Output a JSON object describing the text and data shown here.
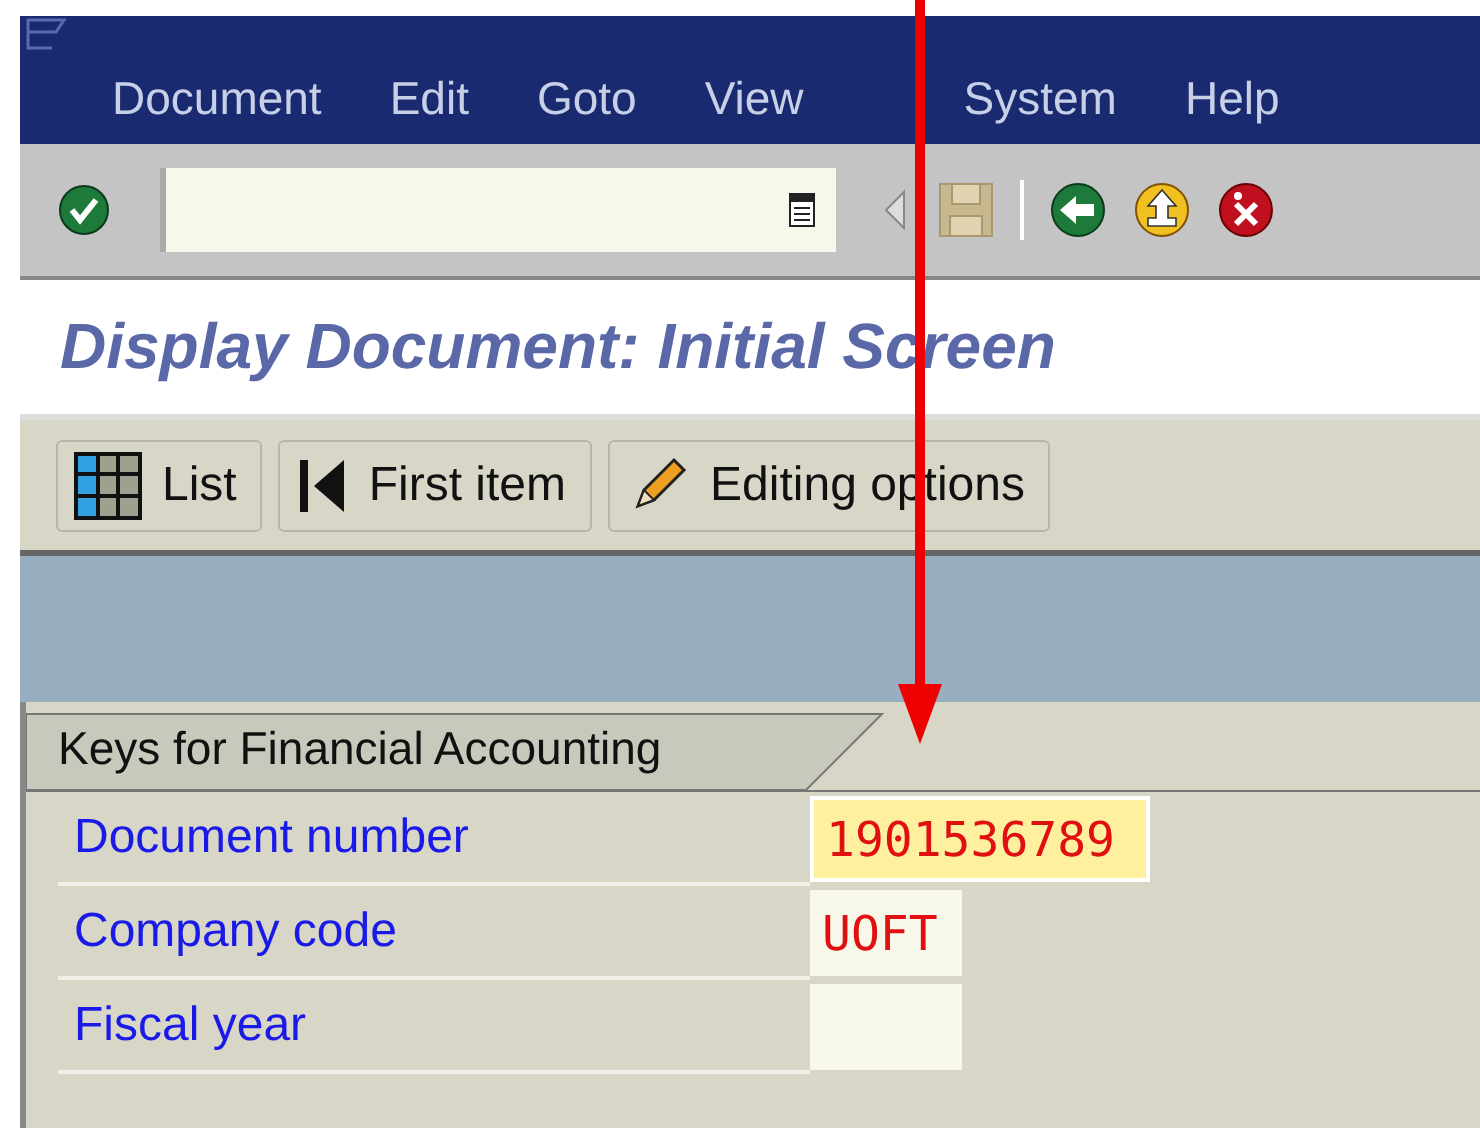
{
  "menu": [
    {
      "label": "Document"
    },
    {
      "label": "Edit"
    },
    {
      "label": "Goto"
    },
    {
      "label": "View"
    },
    {
      "label": "System"
    },
    {
      "label": "Help"
    }
  ],
  "title": "Display Document: Initial Screen",
  "app_toolbar": [
    {
      "label": "List",
      "kind": "grid"
    },
    {
      "label": "First item",
      "kind": "first"
    },
    {
      "label": "Editing options",
      "kind": "pencil"
    }
  ],
  "section": {
    "tab": "Keys for Financial Accounting",
    "fields": [
      {
        "label": "Document number",
        "value": "1901536789",
        "focused": true,
        "wide": true
      },
      {
        "label": "Company code",
        "value": "UOFT",
        "focused": false,
        "wide": false
      },
      {
        "label": "Fiscal year",
        "focused": false,
        "wide": false
      }
    ]
  }
}
